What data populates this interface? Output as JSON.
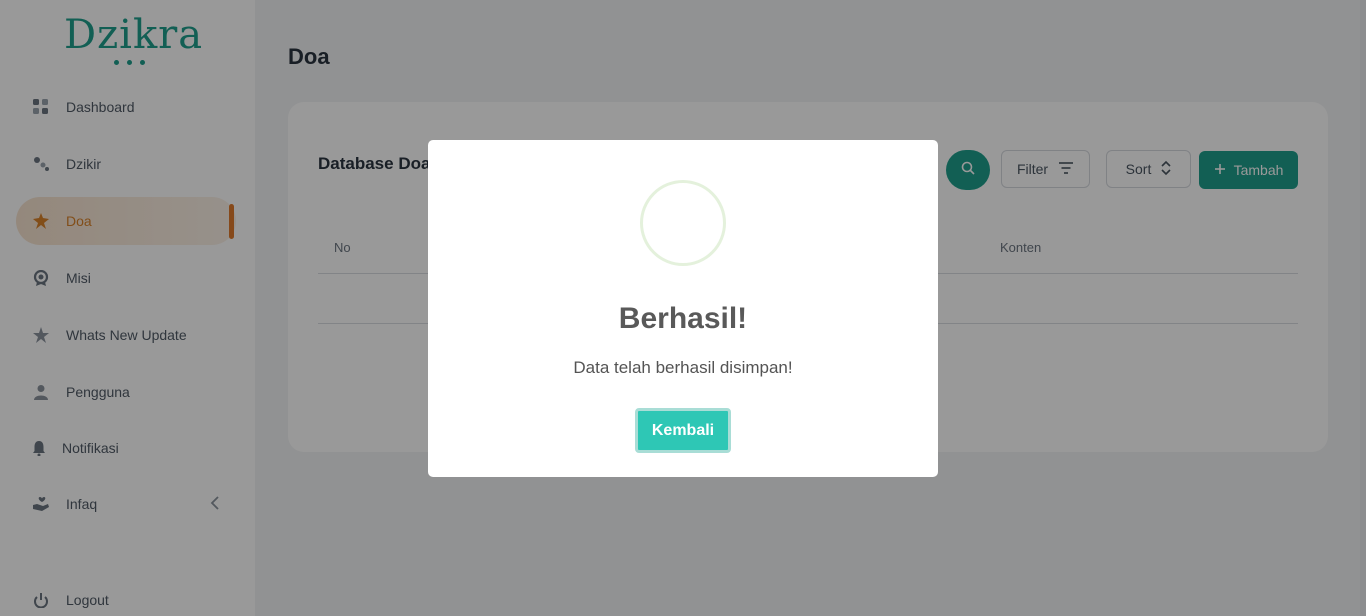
{
  "app": {
    "logo": "Dzikra"
  },
  "sidebar": {
    "items": [
      {
        "label": "Dashboard",
        "icon": "dashboard-icon"
      },
      {
        "label": "Dzikir",
        "icon": "dzikir-icon"
      },
      {
        "label": "Doa",
        "icon": "doa-icon",
        "active": true
      },
      {
        "label": "Misi",
        "icon": "badge-icon"
      },
      {
        "label": "Whats New Update",
        "icon": "star-icon"
      },
      {
        "label": "Pengguna",
        "icon": "user-icon"
      },
      {
        "label": "Notifikasi",
        "icon": "bell-icon"
      },
      {
        "label": "Infaq",
        "icon": "hand-heart-icon"
      }
    ],
    "logout": "Logout"
  },
  "main": {
    "title": "Doa",
    "card": {
      "title": "Database Doa",
      "filter_label": "Filter",
      "sort_label": "Sort",
      "add_label": "Tambah",
      "columns": [
        "No",
        "Konten"
      ]
    }
  },
  "modal": {
    "title": "Berhasil!",
    "message": "Data telah berhasil disimpan!",
    "button": "Kembali"
  },
  "colors": {
    "brand": "#1f9e8c",
    "active": "#d9822b",
    "confirm_button": "#2ec7b5"
  }
}
